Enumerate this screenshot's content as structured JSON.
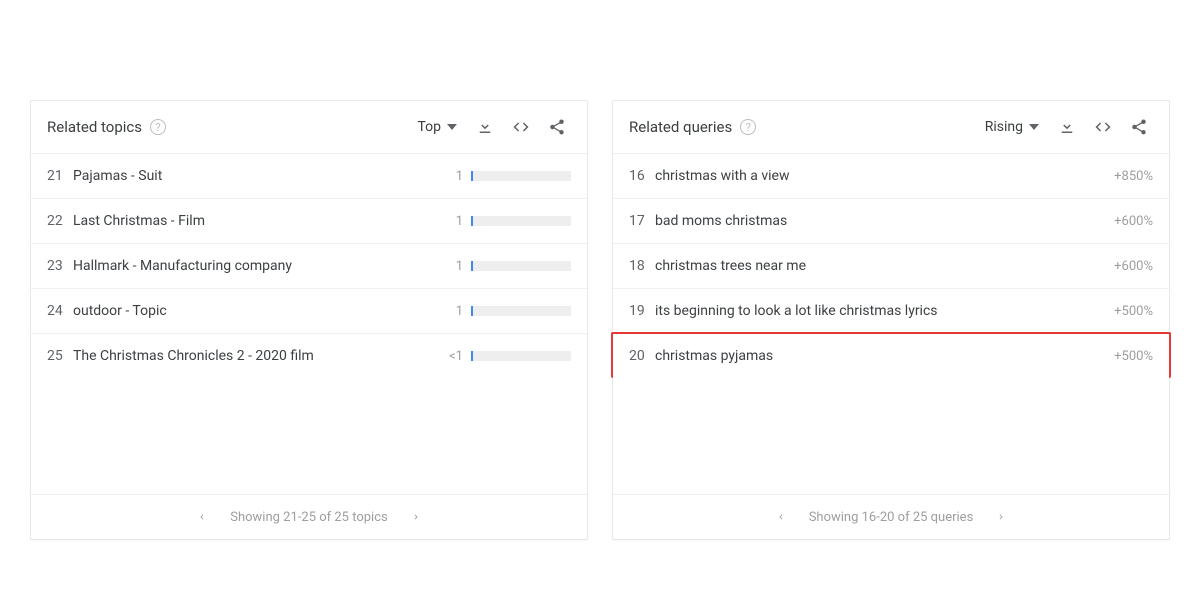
{
  "topics": {
    "title": "Related topics",
    "sort": "Top",
    "items": [
      {
        "rank": "21",
        "label": "Pajamas - Suit",
        "value": "1"
      },
      {
        "rank": "22",
        "label": "Last Christmas - Film",
        "value": "1"
      },
      {
        "rank": "23",
        "label": "Hallmark - Manufacturing company",
        "value": "1"
      },
      {
        "rank": "24",
        "label": "outdoor - Topic",
        "value": "1"
      },
      {
        "rank": "25",
        "label": "The Christmas Chronicles 2 - 2020 film",
        "value": "<1"
      }
    ],
    "pager": "Showing 21-25 of 25 topics"
  },
  "queries": {
    "title": "Related queries",
    "sort": "Rising",
    "items": [
      {
        "rank": "16",
        "label": "christmas with a view",
        "pct": "+850%"
      },
      {
        "rank": "17",
        "label": "bad moms christmas",
        "pct": "+600%"
      },
      {
        "rank": "18",
        "label": "christmas trees near me",
        "pct": "+600%"
      },
      {
        "rank": "19",
        "label": "its beginning to look a lot like christmas lyrics",
        "pct": "+500%"
      },
      {
        "rank": "20",
        "label": "christmas pyjamas",
        "pct": "+500%",
        "highlight": true
      }
    ],
    "pager": "Showing 16-20 of 25 queries"
  }
}
